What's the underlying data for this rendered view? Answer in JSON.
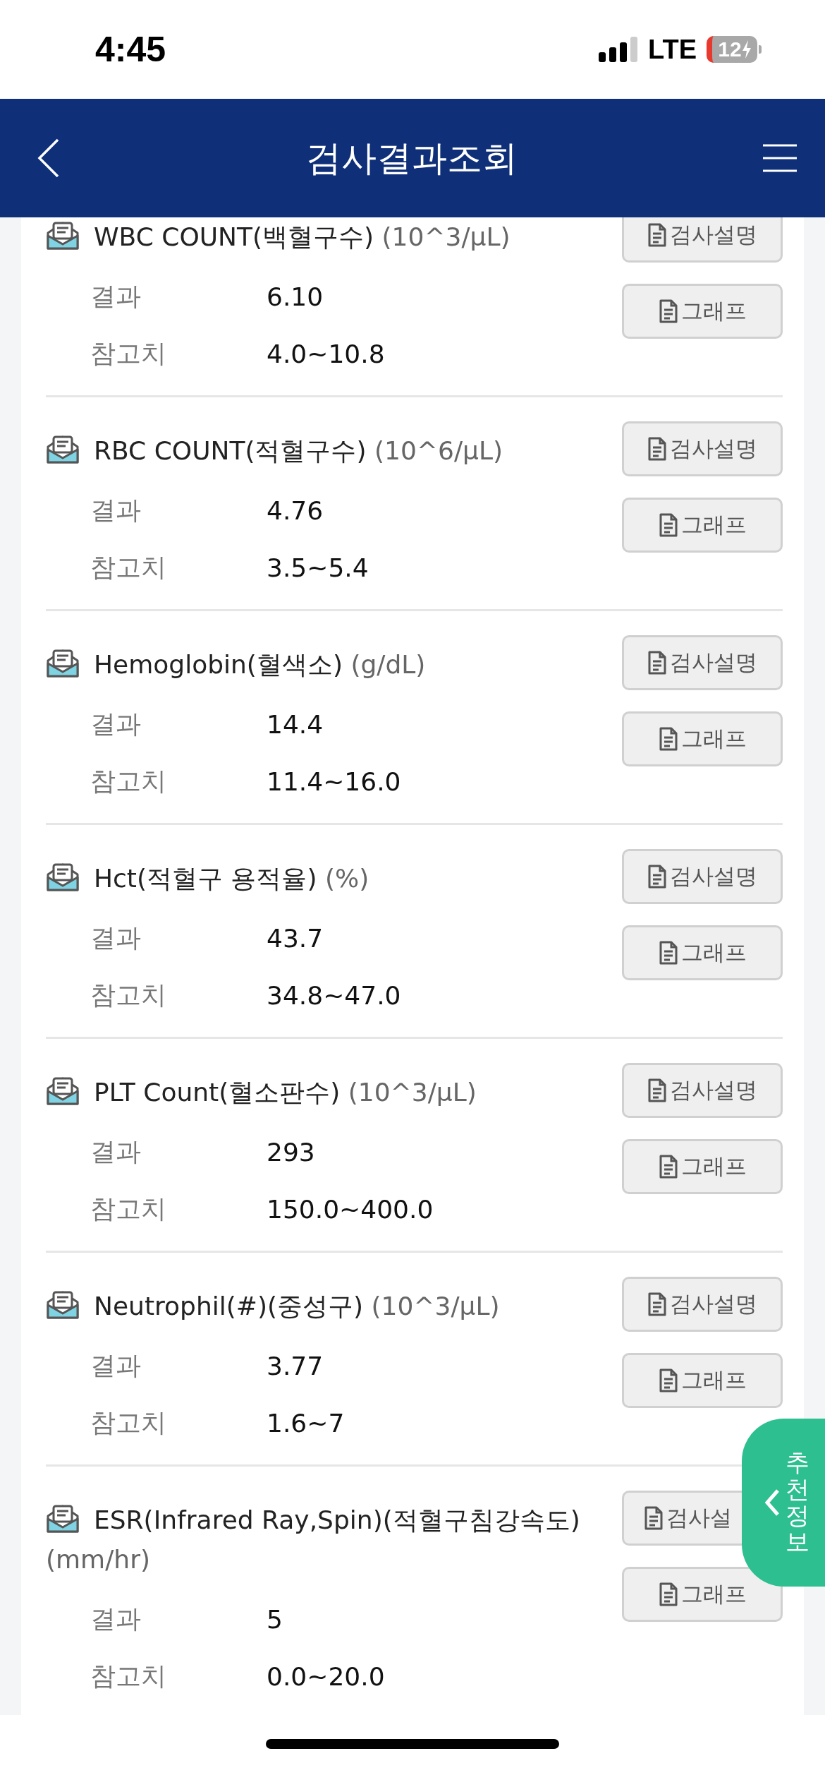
{
  "status_bar": {
    "time": "4:45",
    "network": "LTE",
    "battery": "12"
  },
  "header": {
    "title": "검사결과조회"
  },
  "results": [
    {
      "name": "WBC COUNT(백혈구수)",
      "unit": "(10^3/μL)",
      "result_label": "결과",
      "result": "6.10",
      "reference_label": "참고치",
      "reference": "4.0~10.8",
      "buttons": [
        "검사설명",
        "그래프"
      ]
    },
    {
      "name": "RBC COUNT(적혈구수)",
      "unit": "(10^6/μL)",
      "result_label": "결과",
      "result": "4.76",
      "reference_label": "참고치",
      "reference": "3.5~5.4",
      "buttons": [
        "검사설명",
        "그래프"
      ]
    },
    {
      "name": "Hemoglobin(혈색소)",
      "unit": "(g/dL)",
      "result_label": "결과",
      "result": "14.4",
      "reference_label": "참고치",
      "reference": "11.4~16.0",
      "buttons": [
        "검사설명",
        "그래프"
      ]
    },
    {
      "name": "Hct(적혈구 용적율)",
      "unit": "(%)",
      "result_label": "결과",
      "result": "43.7",
      "reference_label": "참고치",
      "reference": "34.8~47.0",
      "buttons": [
        "검사설명",
        "그래프"
      ]
    },
    {
      "name": "PLT Count(혈소판수)",
      "unit": "(10^3/μL)",
      "result_label": "결과",
      "result": "293",
      "reference_label": "참고치",
      "reference": "150.0~400.0",
      "buttons": [
        "검사설명",
        "그래프"
      ]
    },
    {
      "name": "Neutrophil(#)(중성구)",
      "unit": "(10^3/μL)",
      "result_label": "결과",
      "result": "3.77",
      "reference_label": "참고치",
      "reference": "1.6~7",
      "buttons": [
        "검사설명",
        "그래프"
      ]
    },
    {
      "name": "ESR(Infrared Ray,Spin)(적혈구침강속도)",
      "unit": "(mm/hr)",
      "result_label": "결과",
      "result": "5",
      "reference_label": "참고치",
      "reference": "0.0~20.0",
      "buttons": [
        "검사설",
        "그래프"
      ]
    }
  ],
  "side_tab": {
    "label": "추천정보"
  }
}
